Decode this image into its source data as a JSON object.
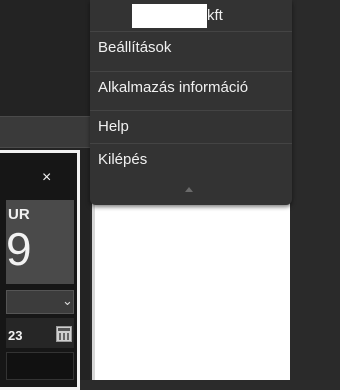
{
  "menu": {
    "company_suffix": "kft",
    "items": [
      {
        "label": "Beállítások"
      },
      {
        "label": "Alkalmazás információ"
      },
      {
        "label": "Help"
      },
      {
        "label": "Kilépés"
      }
    ],
    "collapse_icon": "triangle-up-icon"
  },
  "left_panel": {
    "close_glyph": "×",
    "month": "UR",
    "day": "9",
    "date_partial": "23",
    "icons": [
      "close-icon",
      "chevron-down-icon",
      "calendar-icon"
    ]
  },
  "colors": {
    "menu_bg": "#333333",
    "menu_text": "#f0f0f0",
    "panel_border": "#f2f2f2",
    "date_box_bg": "#4a4a4a"
  }
}
